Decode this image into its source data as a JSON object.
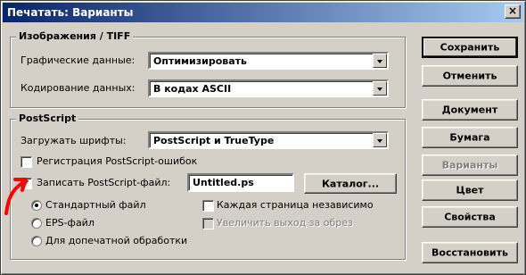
{
  "window": {
    "title": "Печатать: Варианты"
  },
  "images_group": {
    "legend": "Изображения / TIFF",
    "graphic_data_label": "Графические данные:",
    "graphic_data_value": "Оптимизировать",
    "encoding_label": "Кодирование данных:",
    "encoding_value": "В кодах ASCII"
  },
  "postscript_group": {
    "legend": "PostScript",
    "load_fonts_label": "Загружать шрифты:",
    "load_fonts_value": "PostScript и TrueType",
    "register_errors_label": "Регистрация PostScript-ошибок",
    "register_errors_checked": false,
    "write_file_label": "Записать PostScript-файл:",
    "write_file_checked": true,
    "filename_value": "Untitled.ps",
    "catalog_button": "Каталог...",
    "radio_standard": "Стандартный файл",
    "radio_eps": "EPS-файл",
    "radio_prepress": "Для допечатной обработки",
    "selected_radio": "standard",
    "each_page_label": "Каждая страница независимо",
    "each_page_checked": false,
    "bleed_label": "Увеличить выход за обрез",
    "bleed_checked": false
  },
  "buttons": {
    "save": "Сохранить",
    "cancel": "Отменить",
    "document": "Документ",
    "paper": "Бумага",
    "variants": "Варианты",
    "color": "Цвет",
    "properties": "Свойства",
    "restore": "Восстановить"
  },
  "colors": {
    "titlebar_start": "#0a246a",
    "titlebar_end": "#a6caf0",
    "annotation_arrow": "#ff0000"
  }
}
